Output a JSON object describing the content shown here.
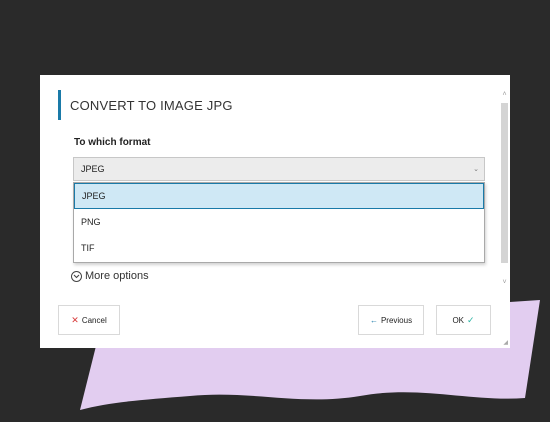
{
  "colors": {
    "background": "#2a2a2a",
    "decorative_shape": "#e2cdf0",
    "accent": "#1a7aa8",
    "selected_option_bg": "#cfe8f5",
    "cancel_icon": "#d83a3a",
    "ok_icon": "#2bb3a3"
  },
  "dialog": {
    "title": "CONVERT TO IMAGE JPG",
    "format_label": "To which format",
    "format_select": {
      "value": "JPEG",
      "options": [
        "JPEG",
        "PNG",
        "TIF"
      ],
      "highlighted_option": "JPEG"
    },
    "more_options_label": "More options",
    "buttons": {
      "cancel": "Cancel",
      "previous": "Previous",
      "ok": "OK"
    }
  }
}
